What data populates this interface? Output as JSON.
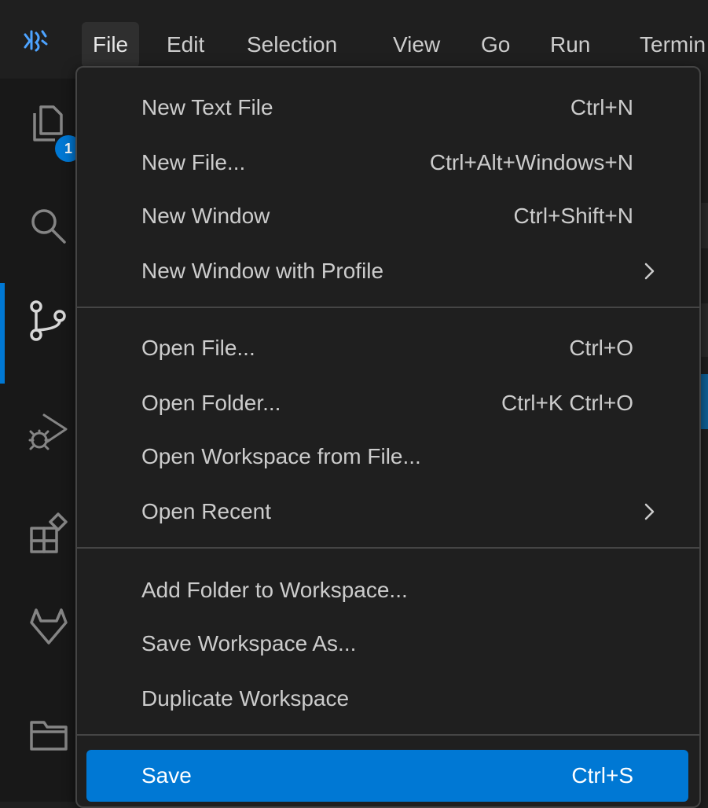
{
  "menubar": {
    "logo_icon": "app-logo-icon",
    "items": [
      {
        "label": "File"
      },
      {
        "label": "Edit"
      },
      {
        "label": "Selection"
      },
      {
        "label": "View"
      },
      {
        "label": "Go"
      },
      {
        "label": "Run"
      },
      {
        "label": "Termin"
      }
    ]
  },
  "activitybar": {
    "explorer_badge": "1",
    "icons": [
      "explorer-icon",
      "search-icon",
      "source-control-icon",
      "run-debug-icon",
      "extensions-icon",
      "gitlab-icon",
      "folder-icon"
    ]
  },
  "file_menu": {
    "groups": [
      [
        {
          "label": "New Text File",
          "shortcut": "Ctrl+N"
        },
        {
          "label": "New File...",
          "shortcut": "Ctrl+Alt+Windows+N"
        },
        {
          "label": "New Window",
          "shortcut": "Ctrl+Shift+N"
        },
        {
          "label": "New Window with Profile",
          "shortcut": "",
          "submenu": true
        }
      ],
      [
        {
          "label": "Open File...",
          "shortcut": "Ctrl+O"
        },
        {
          "label": "Open Folder...",
          "shortcut": "Ctrl+K Ctrl+O"
        },
        {
          "label": "Open Workspace from File...",
          "shortcut": ""
        },
        {
          "label": "Open Recent",
          "shortcut": "",
          "submenu": true
        }
      ],
      [
        {
          "label": "Add Folder to Workspace...",
          "shortcut": ""
        },
        {
          "label": "Save Workspace As...",
          "shortcut": ""
        },
        {
          "label": "Duplicate Workspace",
          "shortcut": ""
        }
      ],
      [
        {
          "label": "Save",
          "shortcut": "Ctrl+S",
          "selected": true
        }
      ]
    ]
  },
  "colors": {
    "accent": "#0078d4",
    "menu_bg": "#1f1f1f",
    "menu_border": "#454545",
    "text": "#cccccc"
  }
}
